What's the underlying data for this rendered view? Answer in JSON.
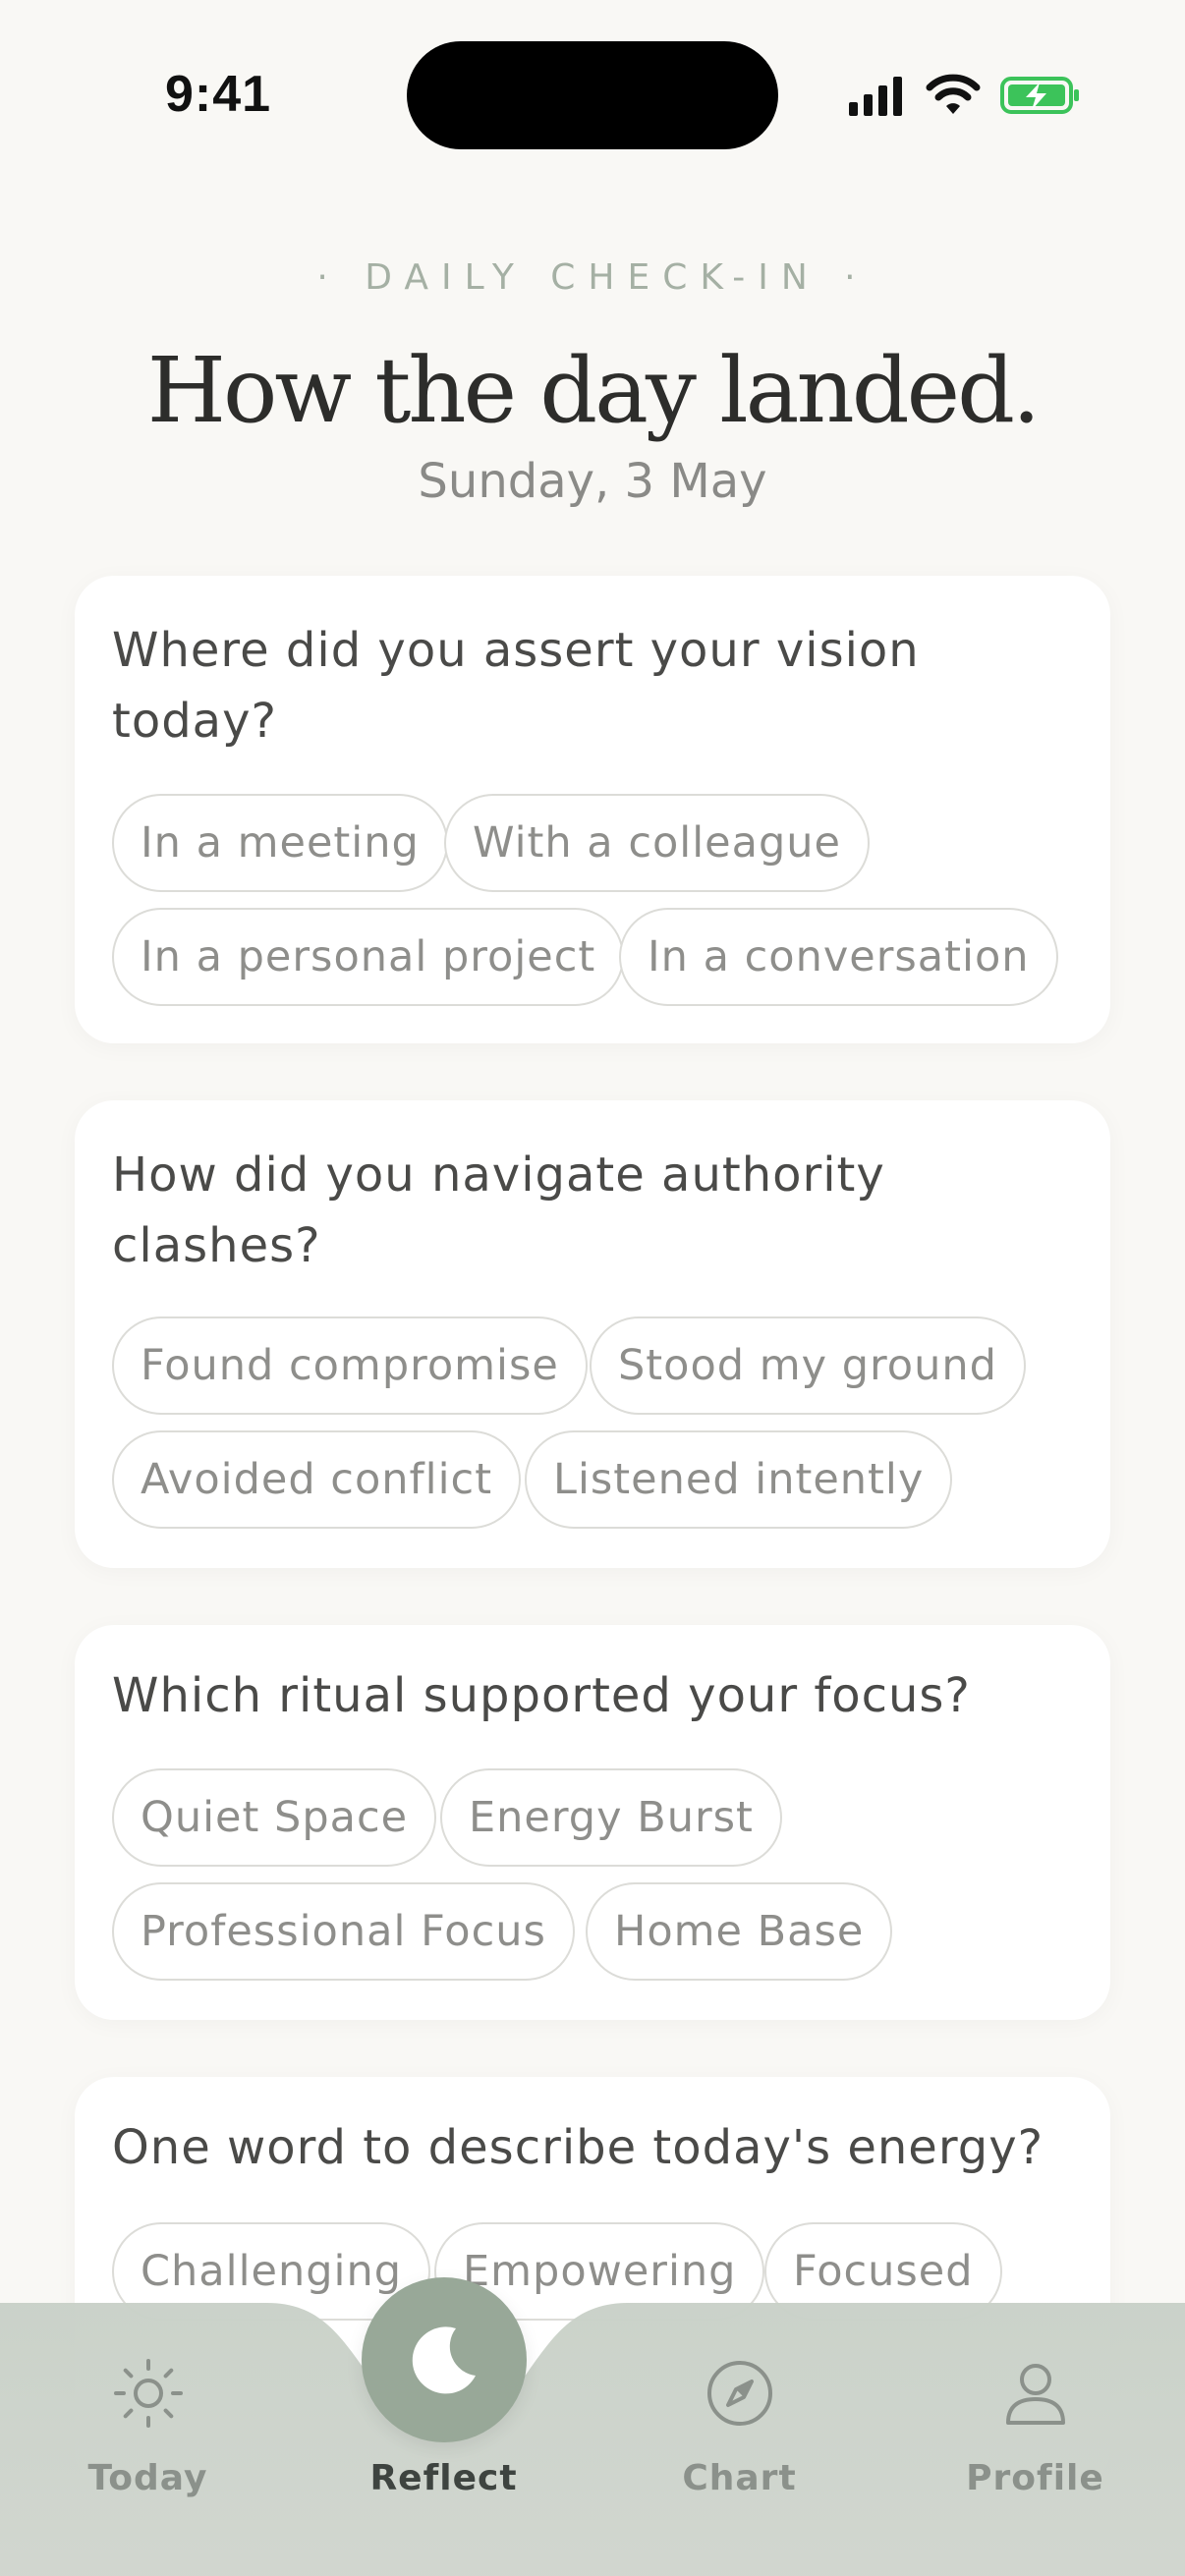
{
  "status_bar": {
    "time": "9:41"
  },
  "header": {
    "eyebrow": "· DAILY CHECK-IN ·",
    "title": "How the day landed.",
    "date": "Sunday, 3 May"
  },
  "cards": [
    {
      "question": "Where did you assert your vision today?",
      "options": [
        "In a meeting",
        "With a colleague",
        "In a personal project",
        "In a conversation"
      ]
    },
    {
      "question": "How did you navigate authority clashes?",
      "options": [
        "Found compromise",
        "Stood my ground",
        "Avoided conflict",
        "Listened intently"
      ]
    },
    {
      "question": "Which ritual supported your focus?",
      "options": [
        "Quiet Space",
        "Energy Burst",
        "Professional Focus",
        "Home Base"
      ]
    },
    {
      "question": "One word to describe today's energy?",
      "options": [
        "Challenging",
        "Empowering",
        "Focused"
      ]
    }
  ],
  "tabbar": {
    "items": [
      {
        "label": "Today",
        "icon": "sun-icon"
      },
      {
        "label": "Reflect",
        "icon": "moon-icon",
        "active": true
      },
      {
        "label": "Chart",
        "icon": "compass-icon"
      },
      {
        "label": "Profile",
        "icon": "person-icon"
      }
    ]
  },
  "colors": {
    "accent": "#98a898",
    "background": "#f9f8f5",
    "tabbar": "#cdd4cc"
  }
}
